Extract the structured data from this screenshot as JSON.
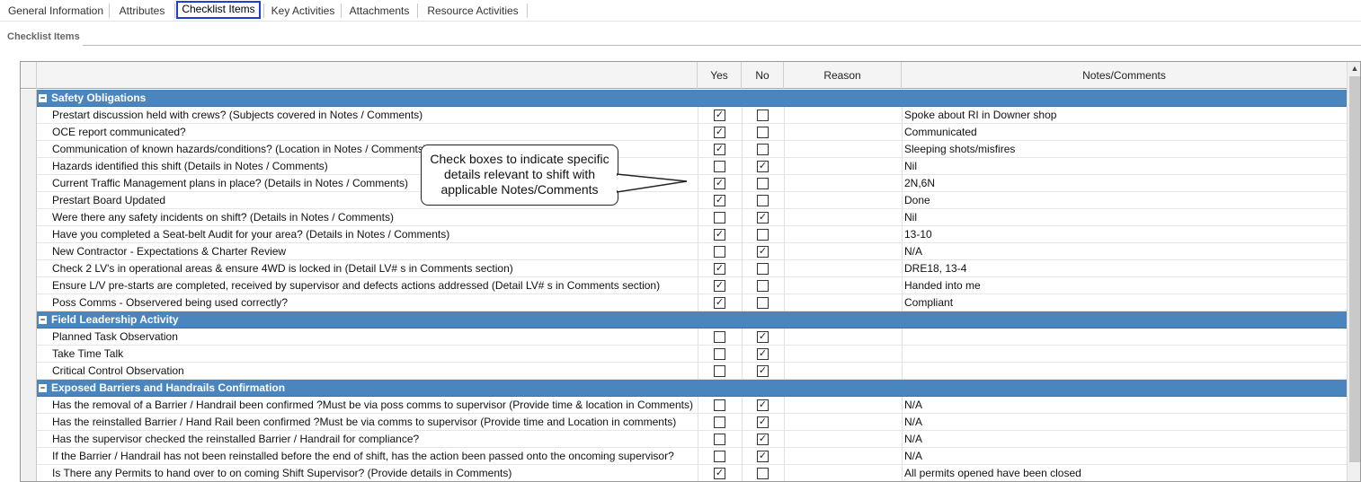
{
  "tabs": [
    {
      "label": "General Information",
      "active": false
    },
    {
      "label": "Attributes",
      "active": false
    },
    {
      "label": "Checklist Items",
      "active": true
    },
    {
      "label": "Key Activities",
      "active": false
    },
    {
      "label": "Attachments",
      "active": false
    },
    {
      "label": "Resource Activities",
      "active": false
    }
  ],
  "section_title": "Checklist Items",
  "columns": {
    "yes": "Yes",
    "no": "No",
    "reason": "Reason",
    "notes": "Notes/Comments"
  },
  "groups": [
    {
      "title": "Safety Obligations",
      "items": [
        {
          "question": "Prestart discussion held with crews? (Subjects covered in Notes / Comments)",
          "yes": true,
          "no": false,
          "notes": "Spoke about RI in Downer shop"
        },
        {
          "question": "OCE report communicated?",
          "yes": true,
          "no": false,
          "notes": "Communicated"
        },
        {
          "question": "Communication of known hazards/conditions? (Location in Notes / Comments)",
          "yes": true,
          "no": false,
          "notes": "Sleeping shots/misfires"
        },
        {
          "question": "Hazards identified this shift (Details in Notes / Comments)",
          "yes": false,
          "no": true,
          "notes": "Nil"
        },
        {
          "question": "Current Traffic Management plans in place? (Details in Notes / Comments)",
          "yes": true,
          "no": false,
          "notes": "2N,6N"
        },
        {
          "question": "Prestart Board Updated",
          "yes": true,
          "no": false,
          "notes": "Done"
        },
        {
          "question": "Were there any safety incidents on shift? (Details in Notes / Comments)",
          "yes": false,
          "no": true,
          "notes": "Nil"
        },
        {
          "question": "Have you completed a Seat-belt Audit for your area? (Details in Notes / Comments)",
          "yes": true,
          "no": false,
          "notes": "13-10"
        },
        {
          "question": "New Contractor - Expectations & Charter Review",
          "yes": false,
          "no": true,
          "notes": "N/A"
        },
        {
          "question": "Check 2 LV's in operational areas & ensure 4WD is locked in (Detail LV# s in Comments section)",
          "yes": true,
          "no": false,
          "notes": "DRE18, 13-4"
        },
        {
          "question": "Ensure L/V pre-starts are completed, received by supervisor and defects actions addressed (Detail LV# s in Comments section)",
          "yes": true,
          "no": false,
          "notes": "Handed into me"
        },
        {
          "question": "Poss Comms - Observered being used correctly?",
          "yes": true,
          "no": false,
          "notes": "Compliant"
        }
      ]
    },
    {
      "title": "Field Leadership Activity",
      "items": [
        {
          "question": "Planned Task Observation",
          "yes": false,
          "no": true,
          "notes": ""
        },
        {
          "question": "Take Time Talk",
          "yes": false,
          "no": true,
          "notes": ""
        },
        {
          "question": "Critical Control Observation",
          "yes": false,
          "no": true,
          "notes": ""
        }
      ]
    },
    {
      "title": "Exposed Barriers and Handrails Confirmation",
      "items": [
        {
          "question": "Has the removal of a Barrier / Handrail been confirmed ?Must be via poss comms to supervisor (Provide time & location in Comments)",
          "yes": false,
          "no": true,
          "notes": "N/A"
        },
        {
          "question": "Has the reinstalled Barrier / Hand Rail been confirmed ?Must be via comms to supervisor (Provide time and Location in comments)",
          "yes": false,
          "no": true,
          "notes": "N/A"
        },
        {
          "question": "Has the supervisor checked the reinstalled Barrier / Handrail for compliance?",
          "yes": false,
          "no": true,
          "notes": "N/A"
        },
        {
          "question": "If the Barrier / Handrail has not been reinstalled before the end of shift, has the action been passed onto the oncoming supervisor?",
          "yes": false,
          "no": true,
          "notes": "N/A"
        },
        {
          "question": "Is There any Permits to hand over to on coming Shift Supervisor? (Provide details in Comments)",
          "yes": true,
          "no": false,
          "notes": "All permits opened have been closed"
        }
      ]
    }
  ],
  "callout": {
    "lines": [
      "Check boxes to indicate specific",
      "details relevant to shift with",
      "applicable Notes/Comments"
    ]
  },
  "colors": {
    "group_header": "#4a86bd",
    "active_tab_border": "#1f3fd1"
  },
  "icons": {
    "group_toggle": "minus-box-icon",
    "scroll_up": "chevron-up-icon",
    "check": "checkmark-icon"
  }
}
